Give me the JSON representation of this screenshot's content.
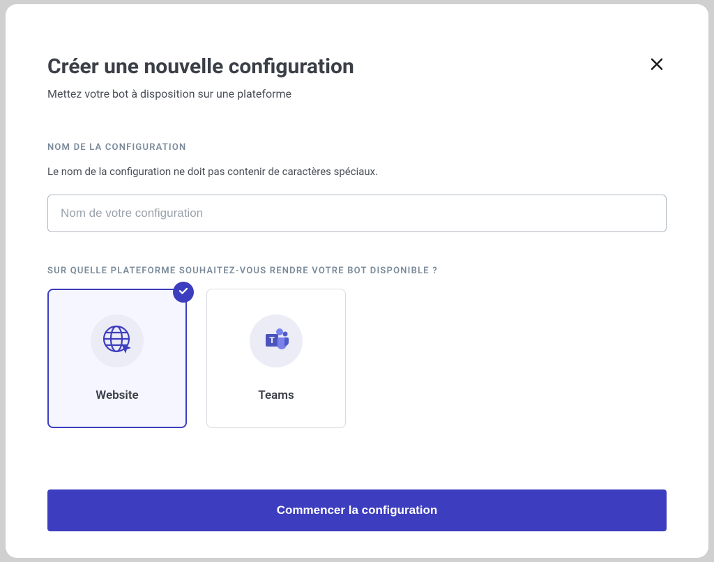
{
  "modal": {
    "title": "Créer une nouvelle configuration",
    "subtitle": "Mettez votre bot à disposition sur une plateforme"
  },
  "name_section": {
    "label": "NOM DE LA CONFIGURATION",
    "helper": "Le nom de la configuration ne doit pas contenir de caractères spéciaux.",
    "placeholder": "Nom de votre configuration",
    "value": ""
  },
  "platform_section": {
    "label": "SUR QUELLE PLATEFORME SOUHAITEZ-VOUS RENDRE VOTRE BOT DISPONIBLE ?",
    "selected_index": 0,
    "options": [
      {
        "label": "Website",
        "icon": "globe-cursor-icon"
      },
      {
        "label": "Teams",
        "icon": "teams-icon"
      }
    ]
  },
  "submit_label": "Commencer la configuration",
  "colors": {
    "primary": "#3d3dbf",
    "icon_bg": "#ececf6",
    "selected_bg": "#f5f6ff"
  }
}
